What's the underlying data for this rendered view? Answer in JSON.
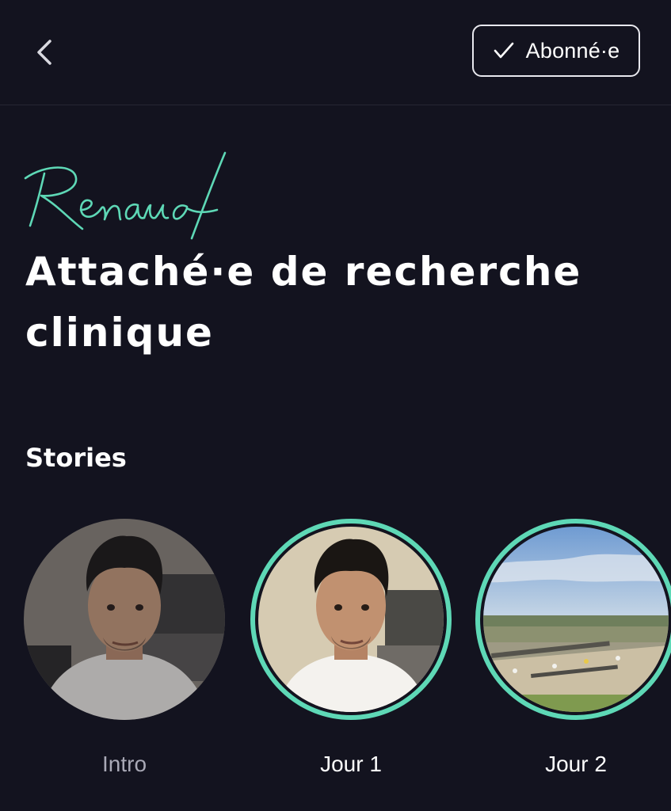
{
  "header": {
    "back_icon": "chevron-left-icon",
    "subscribe_label": "Abonné·e",
    "subscribe_icon": "checkmark-icon"
  },
  "profile": {
    "signature": "Renaud",
    "job_title": "Attaché·e de recherche clinique"
  },
  "stories": {
    "title": "Stories",
    "items": [
      {
        "label": "Intro",
        "seen": true,
        "thumbnail": "person-selfie"
      },
      {
        "label": "Jour 1",
        "seen": false,
        "thumbnail": "person-selfie"
      },
      {
        "label": "Jour 2",
        "seen": false,
        "thumbnail": "airport-aerial-view"
      }
    ]
  },
  "colors": {
    "background": "#13131f",
    "accent": "#5ed8b6",
    "text": "#ffffff",
    "muted_text": "#a9a9b6"
  }
}
